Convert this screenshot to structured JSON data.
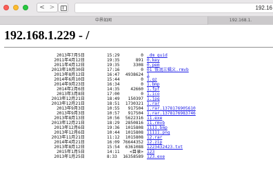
{
  "browser": {
    "back_label": "<",
    "forward_label": ">",
    "address": "192.16",
    "tabs": [
      {
        "label": "中界如闻"
      },
      {
        "label": "192.168.1."
      }
    ]
  },
  "page": {
    "title": "192.168.1.229 - /"
  },
  "listing": [
    {
      "date": "2013年7月5日",
      "time": "15:29",
      "size": "0",
      "name": ".dm_guid"
    },
    {
      "date": "2011年4月12日",
      "time": "19:35",
      "size": "891",
      "name": "0.key"
    },
    {
      "date": "2011年4月12日",
      "time": "19:35",
      "size": "3308",
      "name": "0.pem"
    },
    {
      "date": "2013年10月30日",
      "time": "17:16",
      "size": "0",
      "name": "01 恢润三辑义.rmvb"
    },
    {
      "date": "2013年8月12日",
      "time": "16:47",
      "size": "4938624",
      "name": "1"
    },
    {
      "date": "2014年6月10日",
      "time": "15:44",
      "size": "0",
      "name": "1.gz"
    },
    {
      "date": "2014年9月23日",
      "time": "16:34",
      "size": "0",
      "name": "1.bmp"
    },
    {
      "date": "2014年2月6日",
      "time": "14:35",
      "size": "42660",
      "name": "1.fpf"
    },
    {
      "date": "2013年3月8日",
      "time": "17:00",
      "size": "0",
      "name": "1.ico"
    },
    {
      "date": "2013年12月21日",
      "time": "18:49",
      "size": "150397",
      "name": "1.jpg"
    },
    {
      "date": "2013年12月21日",
      "time": "18:51",
      "size": "1730321",
      "name": "1.rar"
    },
    {
      "date": "2013年9月3日",
      "time": "10:55",
      "size": "917504",
      "name": "1.rar.1378176905610"
    },
    {
      "date": "2013年9月3日",
      "time": "10:57",
      "size": "917504",
      "name": "1.rar.1378176983746"
    },
    {
      "date": "2013年8月13日",
      "time": "10:56",
      "size": "5622316",
      "name": "11.exe"
    },
    {
      "date": "2013年12月21日",
      "time": "18:29",
      "size": "2850816",
      "name": "11.rmvb"
    },
    {
      "date": "2013年12月6日",
      "time": "19:36",
      "size": "1015808",
      "name": "1111.bmp"
    },
    {
      "date": "2013年12月6日",
      "time": "10:44",
      "size": "1015808",
      "name": "11111.png"
    },
    {
      "date": "2013年11月21日",
      "time": "11:12",
      "size": "1015808",
      "name": "12.rar"
    },
    {
      "date": "2014年4月21日",
      "time": "16:09",
      "size": "76644352",
      "name": "12.zip"
    },
    {
      "date": "2013年8月12日",
      "time": "15:54",
      "size": "6361088",
      "name": "1223432423.txt"
    },
    {
      "date": "2015年1月5日",
      "time": "14:11",
      "size": "<目录>",
      "name": "123"
    },
    {
      "date": "2013年1月25日",
      "time": "8:33",
      "size": "16358589",
      "name": "123.exe"
    }
  ]
}
